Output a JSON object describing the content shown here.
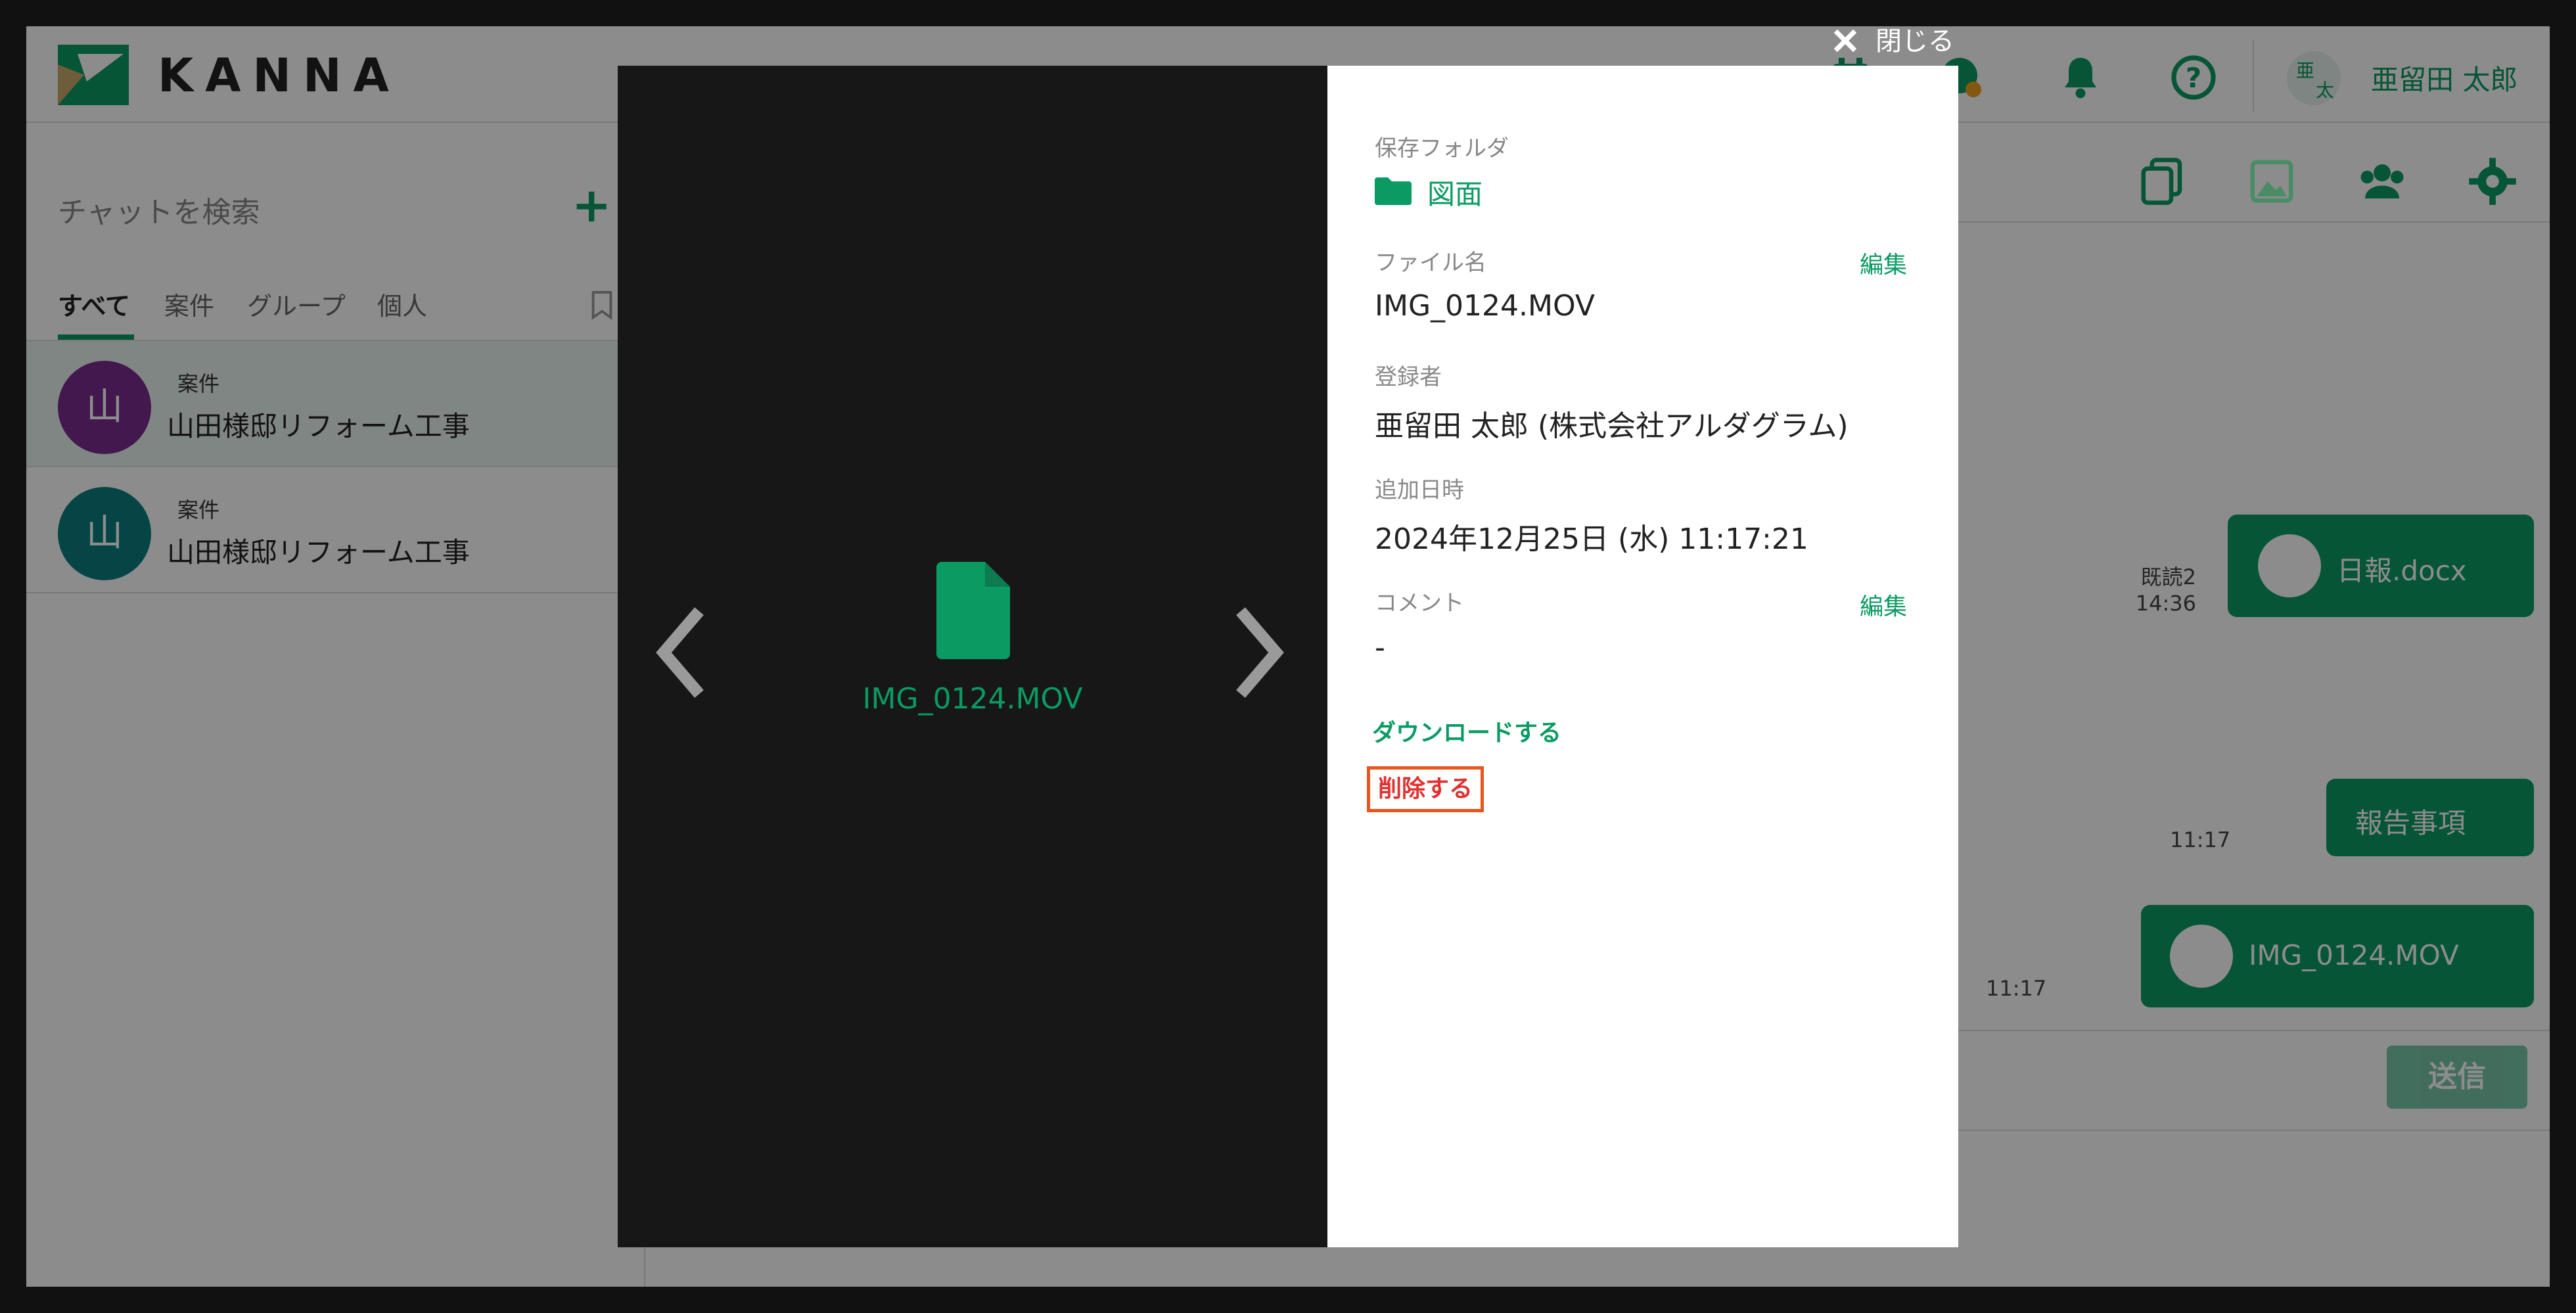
{
  "app": {
    "logo_text": "KANNA",
    "user_avatar": [
      "亜",
      "太"
    ],
    "user_name": "亜留田 太郎"
  },
  "sidebar": {
    "search_placeholder": "チャットを検索",
    "tabs": [
      "すべて",
      "案件",
      "グループ",
      "個人"
    ],
    "chats": [
      {
        "avatar": "山",
        "tag": "案件",
        "title": "山田様邸リフォーム工事",
        "color": "#7b2d8e"
      },
      {
        "avatar": "山",
        "tag": "案件",
        "title": "山田様邸リフォーム工事",
        "color": "#0a7f80"
      }
    ]
  },
  "messages": [
    {
      "label": "日報.docx",
      "read": "既読2",
      "time": "14:36",
      "has_icon": true
    },
    {
      "label": "報告事項",
      "time": "11:17",
      "has_icon": false
    },
    {
      "label": "IMG_0124.MOV",
      "time": "11:17",
      "has_icon": true
    }
  ],
  "composer": {
    "send_label": "送信"
  },
  "overlay": {
    "close_label": "閉じる",
    "viewer_filename": "IMG_0124.MOV",
    "folder_label": "保存フォルダ",
    "folder_name": "図面",
    "filename_label": "ファイル名",
    "filename_value": "IMG_0124.MOV",
    "registrant_label": "登録者",
    "registrant_value": "亜留田 太郎 (株式会社アルダグラム)",
    "added_label": "追加日時",
    "added_value": "2024年12月25日 (水) 11:17:21",
    "comment_label": "コメント",
    "comment_value": "-",
    "edit_label": "編集",
    "download_label": "ダウンロードする",
    "delete_label": "削除する"
  },
  "colors": {
    "accent": "#0a9b63",
    "delete": "#e03030",
    "delete_highlight": "#e8551e",
    "viewer_bg": "#171717"
  }
}
